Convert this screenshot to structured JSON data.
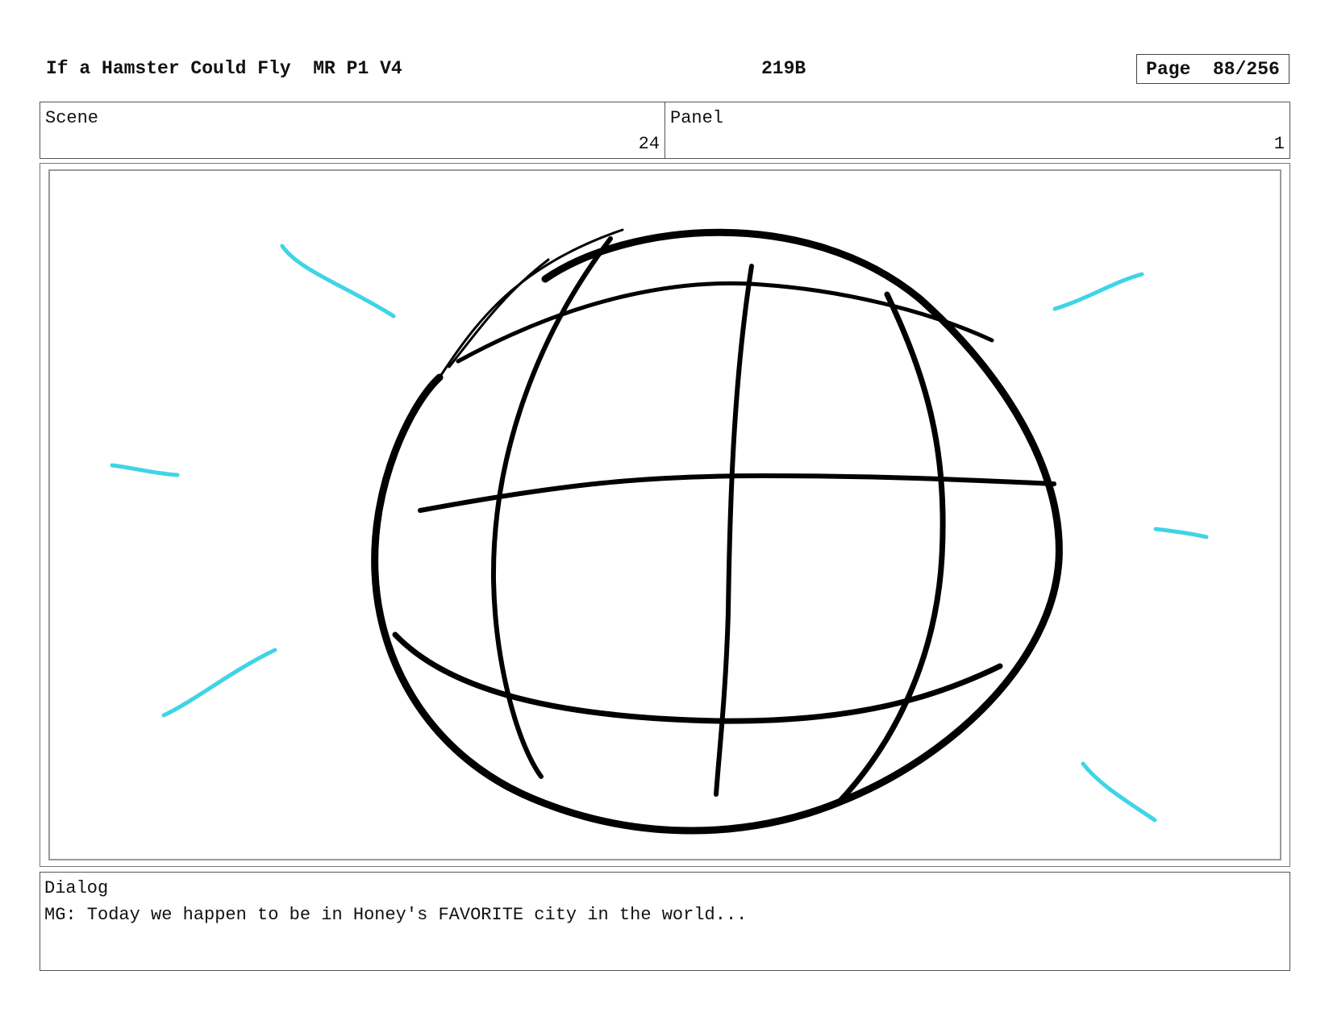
{
  "header": {
    "title": "If a Hamster Could Fly  MR P1 V4",
    "code": "219B",
    "page": "Page  88/256"
  },
  "scene": {
    "label": "Scene",
    "value": "24"
  },
  "panel": {
    "label": "Panel",
    "value": "1"
  },
  "artwork": {
    "subject": "globe-sketch",
    "line_color": "#000000",
    "accent_color": "#3fd4e6"
  },
  "dialog": {
    "label": "Dialog",
    "text": "MG: Today we happen to be in Honey's FAVORITE city in the world..."
  }
}
